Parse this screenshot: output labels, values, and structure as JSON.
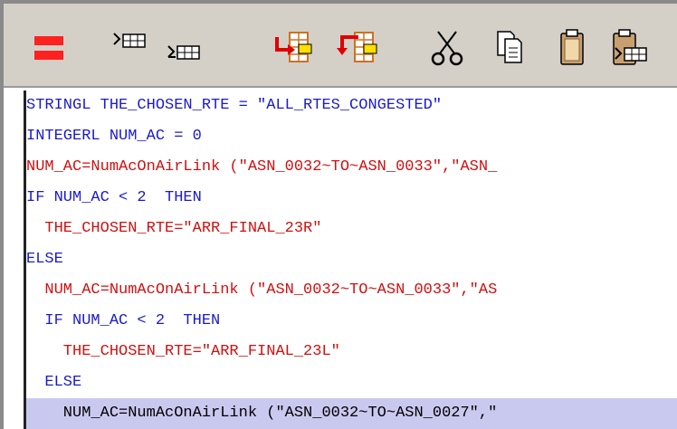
{
  "toolbar": {
    "buttons": [
      {
        "name": "stop-button",
        "icon": "equals-red-icon"
      },
      {
        "name": "insert-block-before-button",
        "icon": "insert-table-indent-icon"
      },
      {
        "name": "insert-block-after-button",
        "icon": "insert-table-small-icon"
      },
      {
        "name": "move-line-in-button",
        "icon": "arrow-into-grid-red-icon"
      },
      {
        "name": "move-line-out-button",
        "icon": "arrow-out-grid-red-icon"
      },
      {
        "name": "cut-button",
        "icon": "scissors-icon"
      },
      {
        "name": "copy-button",
        "icon": "copy-pages-icon"
      },
      {
        "name": "paste-button",
        "icon": "clipboard-icon"
      },
      {
        "name": "paste-special-button",
        "icon": "clipboard-table-icon"
      }
    ]
  },
  "editor": {
    "lines": [
      {
        "text": "STRINGL THE_CHOSEN_RTE = \"ALL_RTES_CONGESTED\"",
        "color": "blue"
      },
      {
        "text": "INTEGERL NUM_AC = 0",
        "color": "blue"
      },
      {
        "text": "NUM_AC=NumAcOnAirLink (\"ASN_0032~TO~ASN_0033\",\"ASN_",
        "color": "red"
      },
      {
        "text": "IF NUM_AC < 2  THEN",
        "color": "blue"
      },
      {
        "text": "  THE_CHOSEN_RTE=\"ARR_FINAL_23R\"",
        "color": "red"
      },
      {
        "text": "ELSE",
        "color": "blue"
      },
      {
        "text": "  NUM_AC=NumAcOnAirLink (\"ASN_0032~TO~ASN_0033\",\"AS",
        "color": "red"
      },
      {
        "text": "  IF NUM_AC < 2  THEN",
        "color": "blue"
      },
      {
        "text": "    THE_CHOSEN_RTE=\"ARR_FINAL_23L\"",
        "color": "red"
      },
      {
        "text": "  ELSE",
        "color": "blue"
      },
      {
        "text": "    NUM_AC=NumAcOnAirLink (\"ASN_0032~TO~ASN_0027\",\"",
        "color": "black",
        "highlighted": true
      }
    ]
  },
  "colors": {
    "keyword_blue": "#1a1acc",
    "string_red": "#d01010",
    "highlight": "#c9c9f0",
    "toolbar_bg": "#d4d0c8"
  }
}
